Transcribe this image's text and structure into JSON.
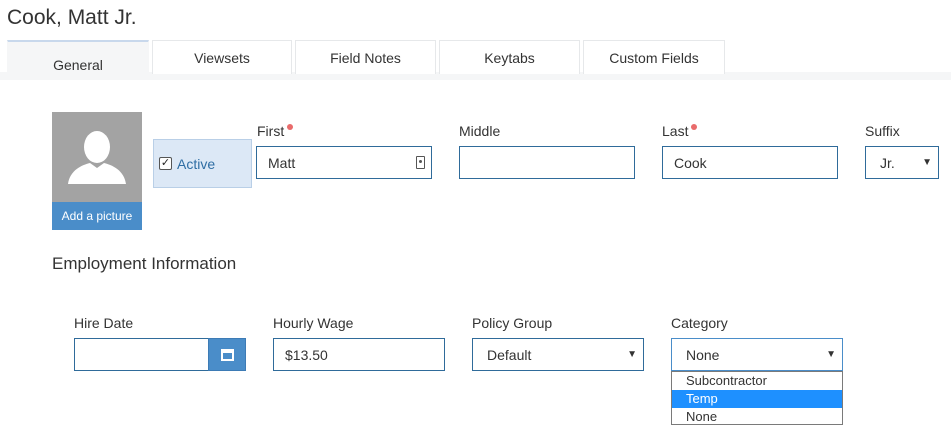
{
  "page": {
    "title": "Cook, Matt Jr."
  },
  "tabs": [
    {
      "label": "General",
      "active": true
    },
    {
      "label": "Viewsets",
      "active": false
    },
    {
      "label": "Field Notes",
      "active": false
    },
    {
      "label": "Keytabs",
      "active": false
    },
    {
      "label": "Custom Fields",
      "active": false
    }
  ],
  "avatar": {
    "add_picture_label": "Add a picture"
  },
  "active_toggle": {
    "label": "Active",
    "checked": true
  },
  "name_fields": {
    "first": {
      "label": "First",
      "value": "Matt",
      "required": true
    },
    "middle": {
      "label": "Middle",
      "value": ""
    },
    "last": {
      "label": "Last",
      "value": "Cook",
      "required": true
    },
    "suffix": {
      "label": "Suffix",
      "value": "Jr."
    }
  },
  "employment": {
    "section_title": "Employment Information",
    "hire_date": {
      "label": "Hire Date",
      "value": ""
    },
    "hourly_wage": {
      "label": "Hourly Wage",
      "value": "$13.50"
    },
    "policy_group": {
      "label": "Policy Group",
      "value": "Default"
    },
    "category": {
      "label": "Category",
      "value": "None",
      "options": [
        "Subcontractor",
        "Temp",
        "None"
      ],
      "highlighted": "Temp"
    }
  },
  "colors": {
    "accent": "#4a8dc9",
    "field_border": "#2f6b9a",
    "required_dot": "#e96b6b",
    "highlight": "#1e90ff"
  },
  "icons": [
    "user-silhouette-icon",
    "checkbox-checked-icon",
    "contact-card-icon",
    "calendar-icon",
    "dropdown-caret-icon"
  ]
}
